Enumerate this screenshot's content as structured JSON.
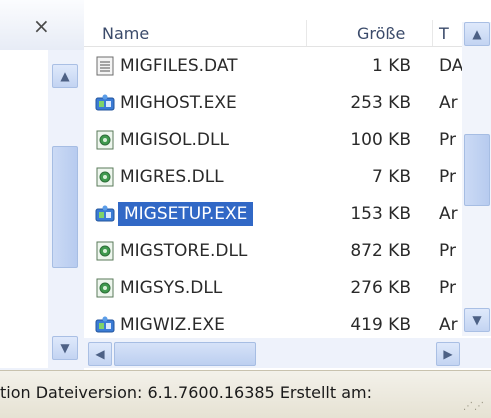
{
  "left_pane": {
    "close_glyph": "×",
    "scroll_up_glyph": "▲",
    "scroll_down_glyph": "▼"
  },
  "columns": {
    "name": "Name",
    "size": "Größe",
    "type": "T"
  },
  "files": [
    {
      "name": "MIGFILES.DAT",
      "size": "1 KB",
      "type": "DA",
      "icon": "dat-file-icon",
      "selected": false
    },
    {
      "name": "MIGHOST.EXE",
      "size": "253 KB",
      "type": "Ar",
      "icon": "exe-app-icon",
      "selected": false
    },
    {
      "name": "MIGISOL.DLL",
      "size": "100 KB",
      "type": "Pr",
      "icon": "dll-file-icon",
      "selected": false
    },
    {
      "name": "MIGRES.DLL",
      "size": "7 KB",
      "type": "Pr",
      "icon": "dll-file-icon",
      "selected": false
    },
    {
      "name": "MIGSETUP.EXE",
      "size": "153 KB",
      "type": "Ar",
      "icon": "exe-app-icon",
      "selected": true
    },
    {
      "name": "MIGSTORE.DLL",
      "size": "872 KB",
      "type": "Pr",
      "icon": "dll-file-icon",
      "selected": false
    },
    {
      "name": "MIGSYS.DLL",
      "size": "276 KB",
      "type": "Pr",
      "icon": "dll-file-icon",
      "selected": false
    },
    {
      "name": "MIGWIZ.EXE",
      "size": "419 KB",
      "type": "Ar",
      "icon": "exe-app-icon",
      "selected": false
    }
  ],
  "right_scroll": {
    "up_glyph": "▲",
    "down_glyph": "▼"
  },
  "h_scroll": {
    "left_glyph": "◀",
    "right_glyph": "▶"
  },
  "status": {
    "text": "tion Dateiversion: 6.1.7600.16385 Erstellt am:"
  },
  "colors": {
    "selection": "#3168c6",
    "scroll_track": "#eef2fb",
    "scroll_button": "#c3d4f2"
  }
}
